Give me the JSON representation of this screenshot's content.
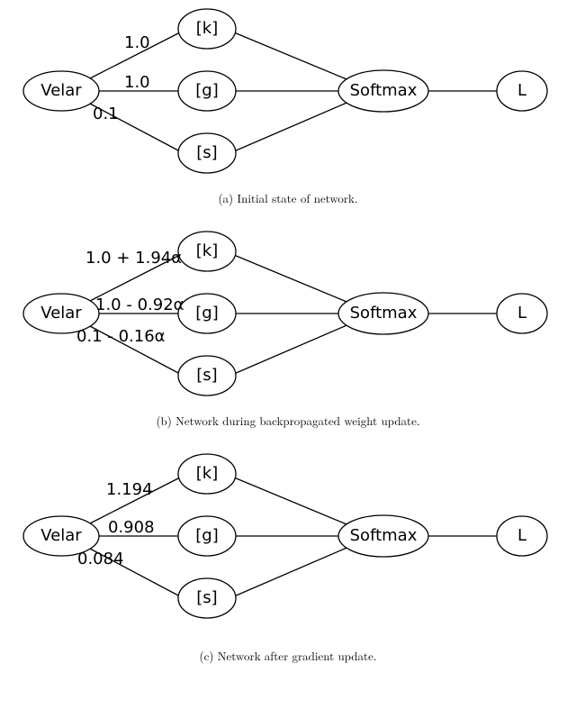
{
  "nodes": {
    "velar": "Velar",
    "k": "[k]",
    "g": "[g]",
    "s": "[s]",
    "softmax": "Softmax",
    "loss": "L"
  },
  "figA": {
    "edges": {
      "k": "1.0",
      "g": "1.0",
      "s": "0.1"
    },
    "caption": "(a) Initial state of network."
  },
  "figB": {
    "edges": {
      "k": "1.0 + 1.94α",
      "g": "1.0 - 0.92α",
      "s": "0.1 - 0.16α"
    },
    "caption": "(b) Network during backpropagated weight update."
  },
  "figC": {
    "edges": {
      "k": "1.194",
      "g": "0.908",
      "s": "0.084"
    },
    "caption": "(c) Network after gradient update."
  },
  "chart_data": [
    {
      "type": "table",
      "title": "(a) Initial state of network",
      "categories": [
        "Velar→[k]",
        "Velar→[g]",
        "Velar→[s]"
      ],
      "values": [
        1.0,
        1.0,
        0.1
      ]
    },
    {
      "type": "table",
      "title": "(b) Network during backpropagated weight update",
      "categories": [
        "Velar→[k]",
        "Velar→[g]",
        "Velar→[s]"
      ],
      "values_expr": [
        "1.0 + 1.94α",
        "1.0 - 0.92α",
        "0.1 - 0.16α"
      ]
    },
    {
      "type": "table",
      "title": "(c) Network after gradient update (α = 0.1 implied)",
      "categories": [
        "Velar→[k]",
        "Velar→[g]",
        "Velar→[s]"
      ],
      "values": [
        1.194,
        0.908,
        0.084
      ]
    }
  ]
}
